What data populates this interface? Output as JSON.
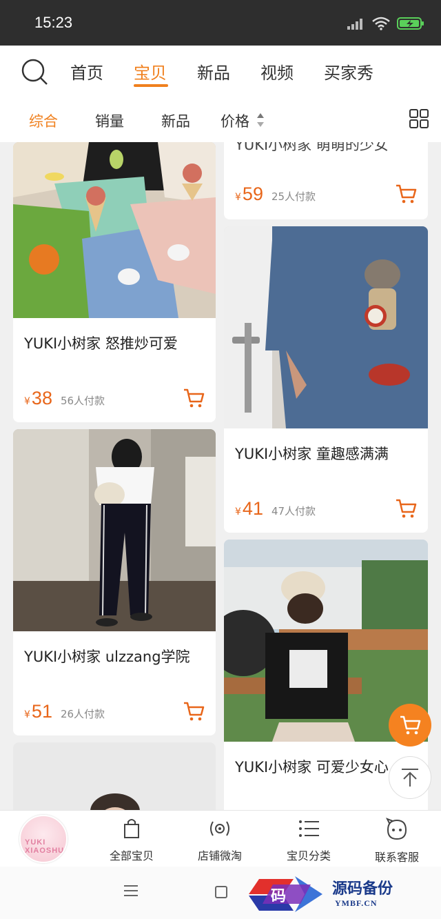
{
  "status_bar": {
    "time": "15:23",
    "icons": [
      "signal-icon",
      "wifi-icon",
      "battery-charging-icon"
    ]
  },
  "top_nav": {
    "tabs": [
      {
        "label": "首页",
        "active": false
      },
      {
        "label": "宝贝",
        "active": true
      },
      {
        "label": "新品",
        "active": false
      },
      {
        "label": "视频",
        "active": false
      },
      {
        "label": "买家秀",
        "active": false
      }
    ]
  },
  "sort_bar": {
    "items": [
      {
        "label": "综合",
        "active": true
      },
      {
        "label": "销量",
        "active": false
      },
      {
        "label": "新品",
        "active": false
      },
      {
        "label": "价格",
        "active": false
      }
    ]
  },
  "products": {
    "left": [
      {
        "title": "YUKI小树家 怒推炒可爱",
        "currency": "¥",
        "price": "38",
        "sold": "56人付款"
      },
      {
        "title": "YUKI小树家 ulzzang学院",
        "currency": "¥",
        "price": "51",
        "sold": "26人付款"
      }
    ],
    "right": [
      {
        "title": "YUKI小树家 萌萌的少女",
        "currency": "¥",
        "price": "59",
        "sold": "25人付款"
      },
      {
        "title": "YUKI小树家 童趣感满满",
        "currency": "¥",
        "price": "41",
        "sold": "47人付款"
      },
      {
        "title": "YUKI小树家 可爱少女心"
      }
    ]
  },
  "bottom_tabs": {
    "shop_avatar_text": "YUKI XIAOSHU",
    "items": [
      {
        "label": "全部宝贝",
        "icon": "shopping-bag-icon"
      },
      {
        "label": "店铺微淘",
        "icon": "broadcast-icon"
      },
      {
        "label": "宝贝分类",
        "icon": "list-icon"
      },
      {
        "label": "联系客服",
        "icon": "service-face-icon"
      }
    ]
  },
  "watermark": {
    "glyph": "码",
    "title": "源码备份",
    "url": "YMBF.CN"
  },
  "colors": {
    "accent": "#f0801e",
    "price": "#e8661a",
    "status_bar": "#2e2e2e",
    "feed_bg": "#f0f0f0"
  }
}
